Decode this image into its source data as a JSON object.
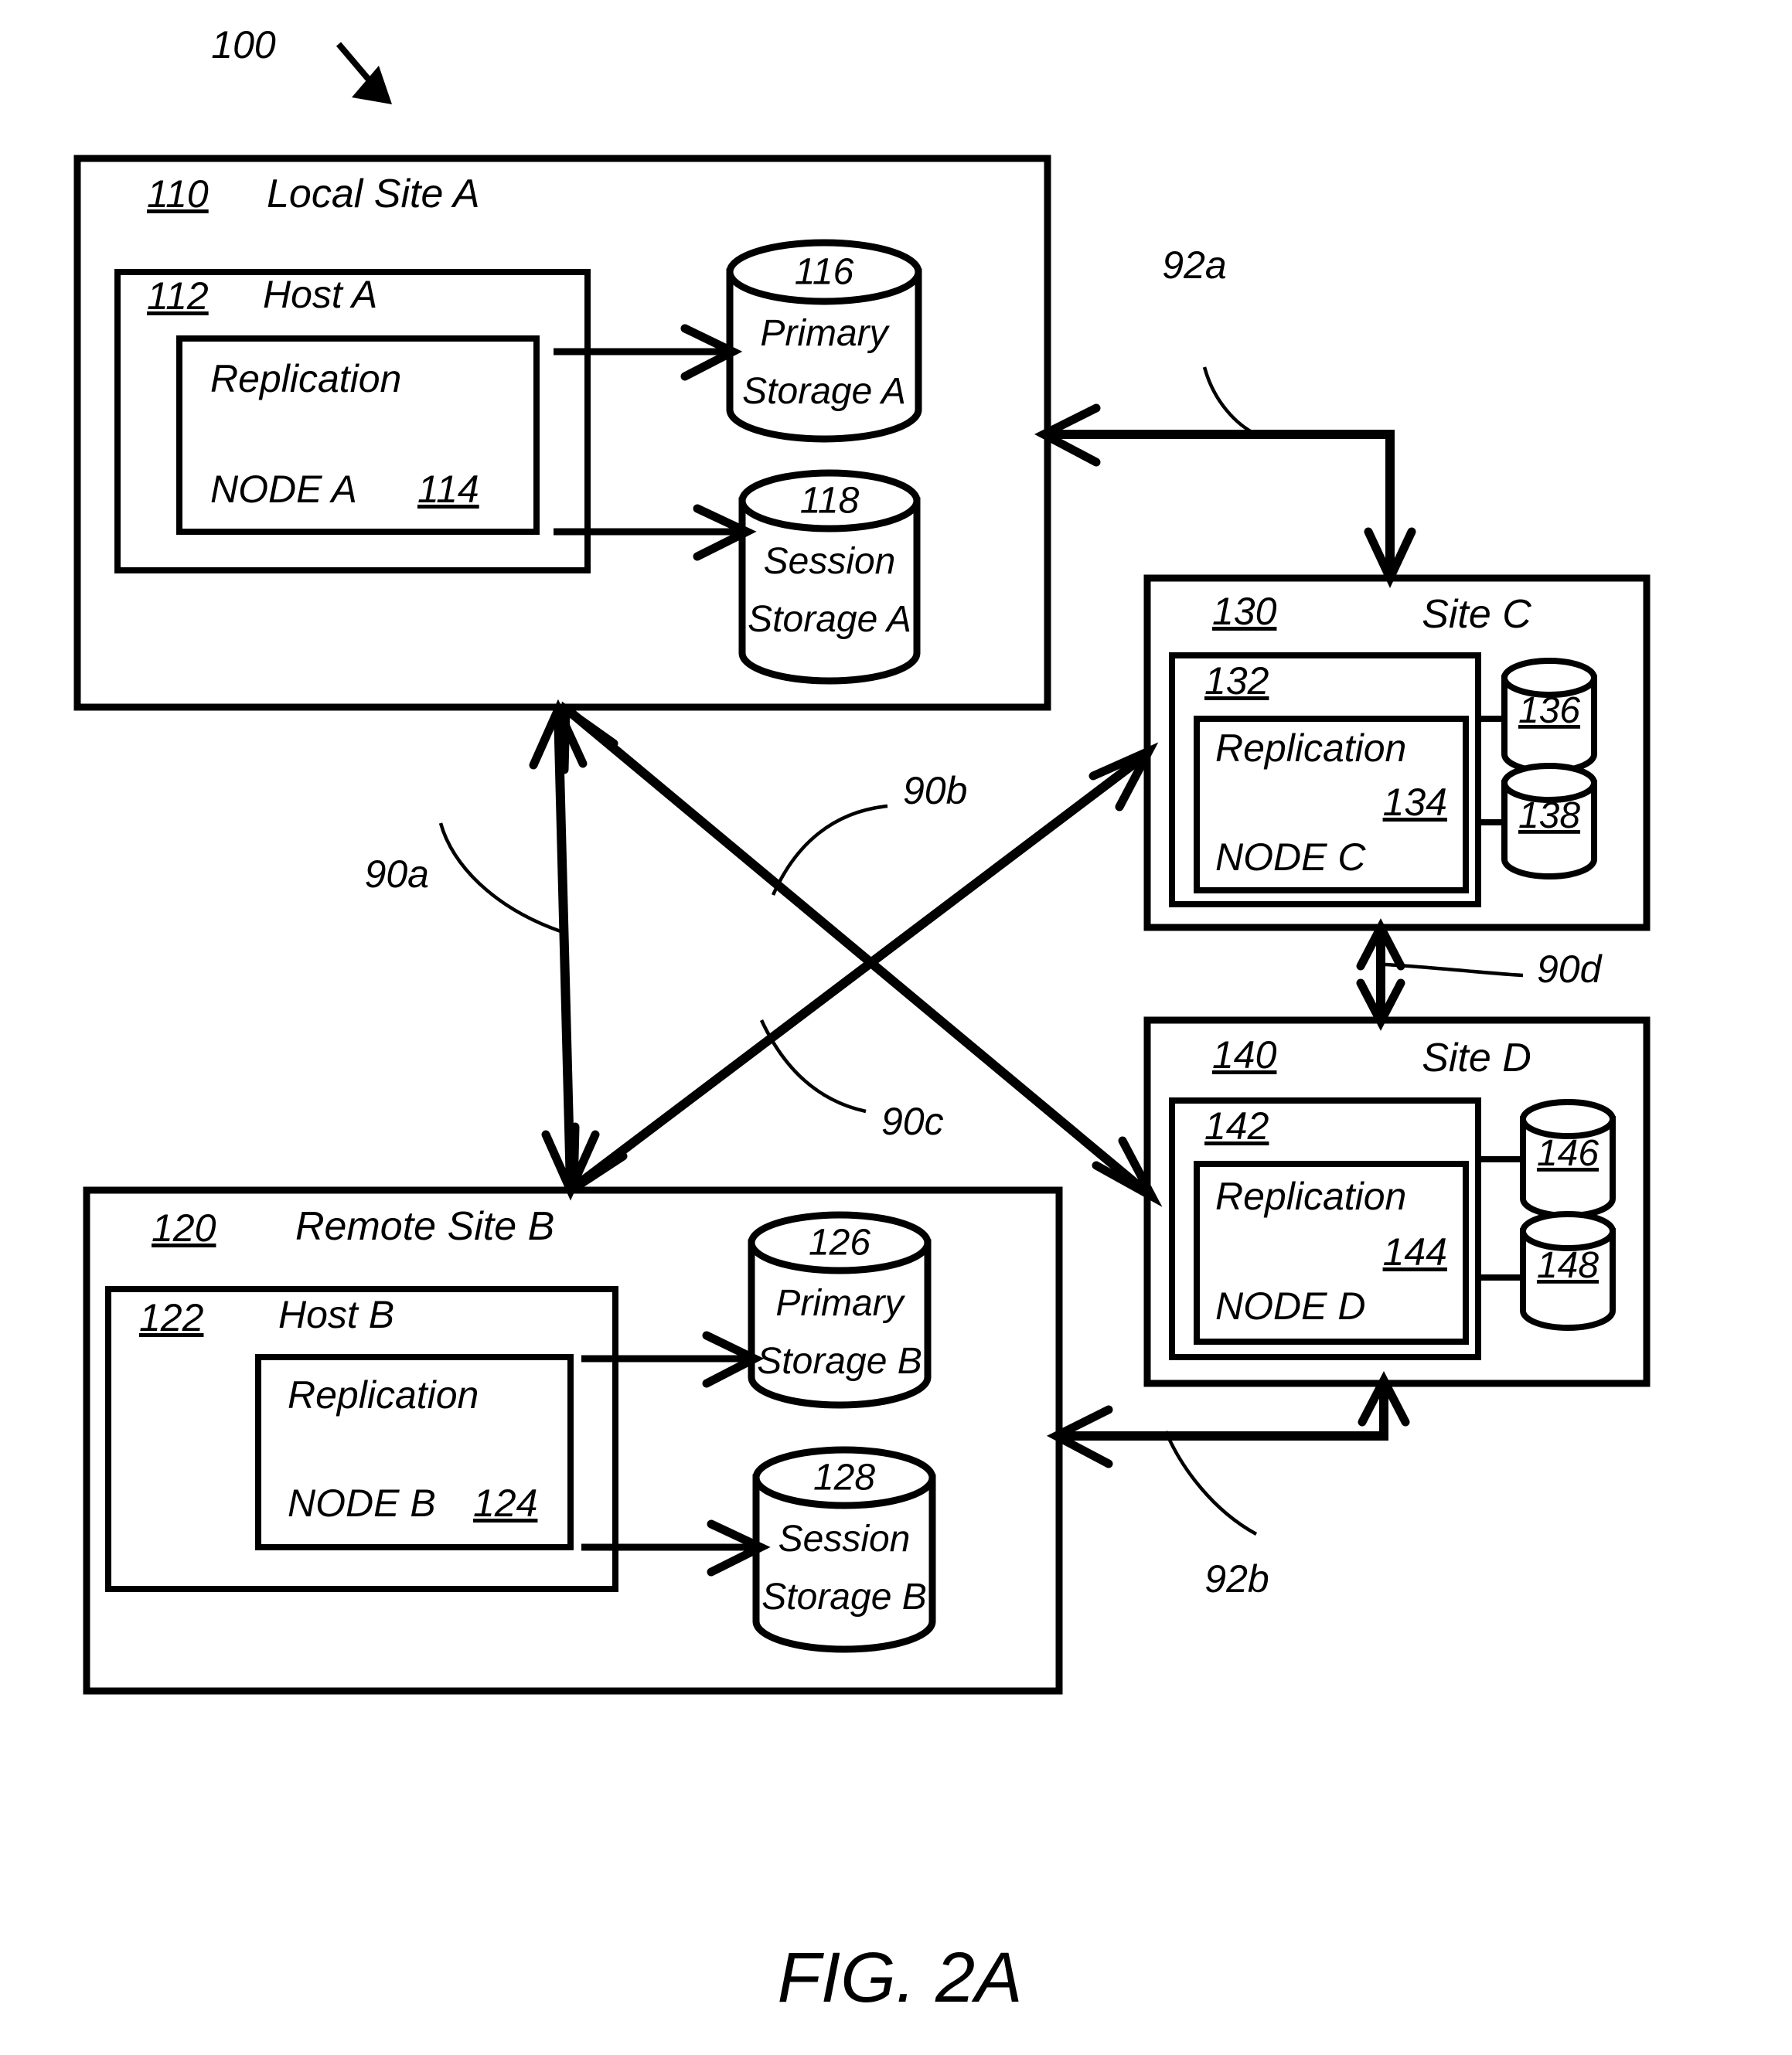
{
  "figure": {
    "caption": "FIG. 2A",
    "system_ref": "100"
  },
  "sites": {
    "a": {
      "ref": "110",
      "title": "Local Site A",
      "host": {
        "ref": "112",
        "title": "Host A",
        "node": {
          "line1": "Replication",
          "line2": "NODE A",
          "ref": "114"
        }
      },
      "storages": [
        {
          "ref": "116",
          "line1": "Primary",
          "line2": "Storage A"
        },
        {
          "ref": "118",
          "line1": "Session",
          "line2": "Storage A"
        }
      ]
    },
    "b": {
      "ref": "120",
      "title": "Remote Site B",
      "host": {
        "ref": "122",
        "title": "Host B",
        "node": {
          "line1": "Replication",
          "line2": "NODE B",
          "ref": "124"
        }
      },
      "storages": [
        {
          "ref": "126",
          "line1": "Primary",
          "line2": "Storage B"
        },
        {
          "ref": "128",
          "line1": "Session",
          "line2": "Storage B"
        }
      ]
    },
    "c": {
      "ref": "130",
      "title": "Site C",
      "inner_ref": "132",
      "node": {
        "line1": "Replication",
        "ref": "134",
        "line2": "NODE C"
      },
      "disks": [
        {
          "ref": "136"
        },
        {
          "ref": "138"
        }
      ]
    },
    "d": {
      "ref": "140",
      "title": "Site D",
      "inner_ref": "142",
      "node": {
        "line1": "Replication",
        "ref": "144",
        "line2": "NODE D"
      },
      "disks": [
        {
          "ref": "146"
        },
        {
          "ref": "148"
        }
      ]
    }
  },
  "links": {
    "l90a": "90a",
    "l90b": "90b",
    "l90c": "90c",
    "l90d": "90d",
    "l92a": "92a",
    "l92b": "92b"
  },
  "colors": {
    "ink": "#000000",
    "paper": "#ffffff"
  }
}
